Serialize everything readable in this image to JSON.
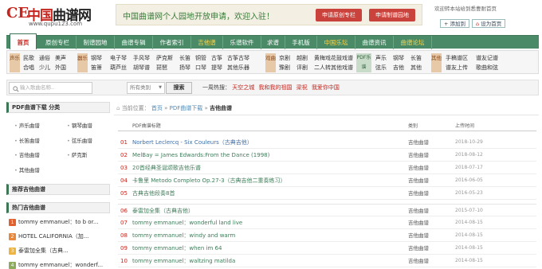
{
  "header": {
    "logo_mark": "CE",
    "logo_text_1": "中国",
    "logo_text_2": "曲谱网",
    "logo_url": "www.qupu123.com",
    "banner_text": "中国曲谱网个人园地开放申请，欢迎入驻！",
    "banner_btn_1": "申请原创专栏",
    "banner_btn_2": "申请制谱园地",
    "welcome": "欢迎转本站给到悉曹耐首页",
    "btn_fav": "+ 添加到",
    "btn_home": "设为首页"
  },
  "nav": {
    "items": [
      "首页",
      "原创专栏",
      "制谱园地",
      "曲谱专辑",
      "作者索引",
      "吉他谱",
      "乐谱软件",
      "求谱",
      "手机版",
      "中国乐坛",
      "曲谱资讯",
      "曲谱论坛"
    ]
  },
  "subnav": {
    "groups": [
      {
        "label": "声乐",
        "items": [
          "民歌",
          "通俗",
          "美声",
          "合唱",
          "少儿",
          "外国"
        ]
      },
      {
        "label": "器乐",
        "items": [
          "钢琴",
          "电子琴",
          "手风琴",
          "萨克斯",
          "长笛",
          "铜管",
          "古筝",
          "古筝古琴",
          "笛箫",
          "葫芦丝",
          "胡琴谱",
          "琵琶",
          "扬琴",
          "口琴",
          "提琴",
          "其他乐器"
        ]
      },
      {
        "label": "戏曲",
        "items": [
          "京剧",
          "越剧",
          "黄梅戏",
          "花鼓戏谱",
          "豫剧",
          "评剧",
          "二人转",
          "其他戏谱"
        ]
      },
      {
        "label": "PDF乐谱",
        "items": [
          "声乐",
          "钢琴",
          "长笛",
          "弦乐",
          "吉他",
          "其他"
        ]
      },
      {
        "label": "其他",
        "items": [
          "手稿谱区",
          "谱友记谱",
          "谱友上传",
          "歌曲和弦"
        ]
      }
    ]
  },
  "search": {
    "placeholder": "输入歌曲名称..",
    "select_value": "所有类别",
    "button": "搜索",
    "hot_label": "一周热搜：",
    "hot_items": [
      "天空之城",
      "我和我的祖国",
      "梁祝",
      "我爱你中国"
    ]
  },
  "sidebar": {
    "pdf_title": "PDF曲谱下载 分类",
    "pdf_cats": [
      "声乐曲谱",
      "钢琴曲谱",
      "长笛曲谱",
      "弦乐曲谱",
      "吉他曲谱",
      "萨克斯",
      "其他曲谱"
    ],
    "rec_title": "推荐吉他曲谱",
    "hot_title": "热门吉他曲谱",
    "hot_songs": [
      "tommy emmanuel：to b or...",
      "HOTEL CALIFORNIA（加...",
      "泰雷加全集（古典...",
      "tommy emmanuel：wonderf..."
    ],
    "hot_colors": [
      "#e0602e",
      "#e8883a",
      "#efb33e",
      "#8cab5b"
    ]
  },
  "main": {
    "breadcrumb_prefix": "当前位置：",
    "crumb_home": "首页",
    "crumb_pdf": "PDF曲谱下载",
    "crumb_current": "吉他曲谱",
    "col_title": "PDF曲谱标题",
    "col_cat": "类别",
    "col_date": "上传时间",
    "rows": [
      {
        "num": "01",
        "title": "Norbert Leclercq - Six Couleurs（古典吉他）",
        "cat": "吉他曲谱",
        "date": "2018-10-29"
      },
      {
        "num": "02",
        "title": "MelBay = James Edwards:From the Dance (1998)",
        "cat": "吉他曲谱",
        "date": "2018-08-12"
      },
      {
        "num": "03",
        "title": "20首经典圣诞颂歌吉他乐谱",
        "cat": "吉他曲谱",
        "date": "2018-07-17"
      },
      {
        "num": "04",
        "title": "卡鲁里 Metodo Completo Op.27-3（古典吉他二重奏练习）",
        "cat": "吉他曲谱",
        "date": "2016-06-05"
      },
      {
        "num": "05",
        "title": "古典吉他段奏8首",
        "cat": "吉他曲谱",
        "date": "2016-05-23"
      },
      {
        "num": "06",
        "title": "泰雷加全集（古典吉他）",
        "cat": "吉他曲谱",
        "date": "2015-07-10"
      },
      {
        "num": "07",
        "title": "tommy emmanuel：wonderful land live",
        "cat": "吉他曲谱",
        "date": "2014-08-15"
      },
      {
        "num": "08",
        "title": "tommy emmanuel：windy and warm",
        "cat": "吉他曲谱",
        "date": "2014-08-15"
      },
      {
        "num": "09",
        "title": "tommy emmanuel：when im 64",
        "cat": "吉他曲谱",
        "date": "2014-08-15"
      },
      {
        "num": "10",
        "title": "tommy emmanuel：waltzing matilda",
        "cat": "吉他曲谱",
        "date": "2014-08-15"
      }
    ]
  }
}
